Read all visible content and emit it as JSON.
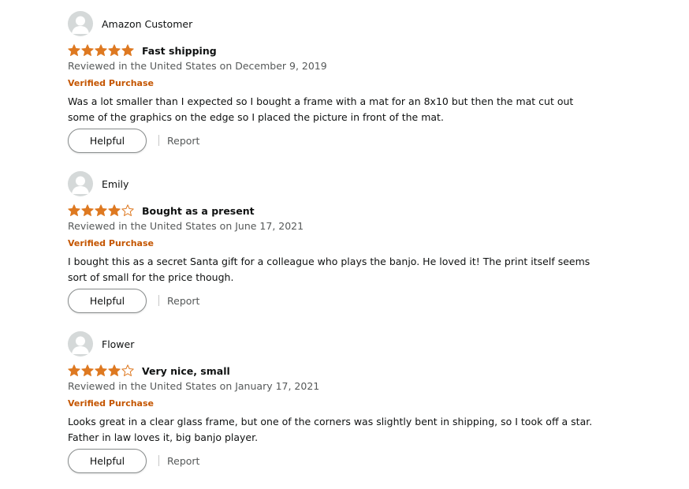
{
  "theme": {
    "star_color": "#de7921",
    "verified_color": "#c45500",
    "avatar_bg": "#d5d9d9"
  },
  "reviews": [
    {
      "author": "Amazon Customer",
      "rating": 5,
      "max_rating": 5,
      "title": "Fast shipping",
      "date": "Reviewed in the United States on December 9, 2019",
      "verified": "Verified Purchase",
      "body_lines": [
        "Was a lot smaller than I expected so I bought a frame with a mat for an 8x10 but then the mat cut out",
        "some of the graphics on the edge so I placed the picture in front of the mat."
      ],
      "helpful_label": "Helpful",
      "report_label": "Report"
    },
    {
      "author": "Emily",
      "rating": 4,
      "max_rating": 5,
      "title": "Bought as a present",
      "date": "Reviewed in the United States on June 17, 2021",
      "verified": "Verified Purchase",
      "body_lines": [
        "I bought this as a secret Santa gift for a colleague who plays the banjo. He loved it! The print itself seems",
        "sort of small for the price though."
      ],
      "helpful_label": "Helpful",
      "report_label": "Report"
    },
    {
      "author": "Flower",
      "rating": 4,
      "max_rating": 5,
      "title": "Very nice, small",
      "date": "Reviewed in the United States on January 17, 2021",
      "verified": "Verified Purchase",
      "body_lines": [
        "Looks great in a clear glass frame, but one of the corners was slightly bent in shipping, so I took off a star.",
        "Father in law loves it, big banjo player."
      ],
      "helpful_label": "Helpful",
      "report_label": "Report"
    }
  ]
}
